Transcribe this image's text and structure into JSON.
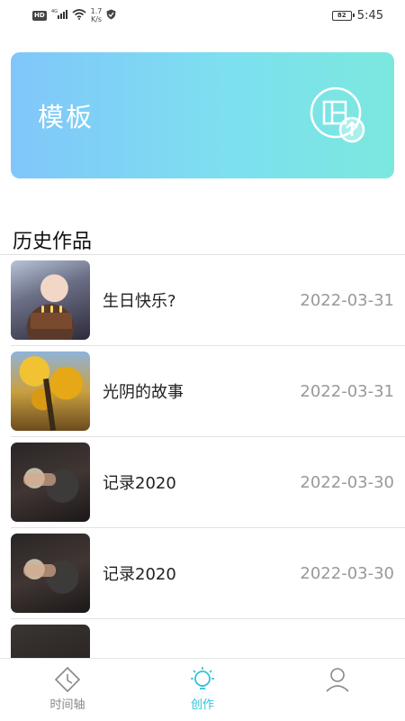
{
  "status_bar": {
    "network_badge": "HD",
    "signal_label": "4G",
    "speed_value": "1.7",
    "speed_unit": "K/s",
    "battery_level": "82",
    "time": "5:45"
  },
  "template_card": {
    "title": "模板",
    "icon": "template-upload-icon",
    "gradient": [
      "#80c6fa",
      "#7be8de"
    ]
  },
  "history": {
    "section_title": "历史作品",
    "items": [
      {
        "title": "生日快乐?",
        "date": "2022-03-31",
        "thumb": "birthday"
      },
      {
        "title": "光阴的故事",
        "date": "2022-03-31",
        "thumb": "tree"
      },
      {
        "title": "记录2020",
        "date": "2022-03-30",
        "thumb": "dark"
      },
      {
        "title": "记录2020",
        "date": "2022-03-30",
        "thumb": "dark"
      },
      {
        "title": "",
        "date": "",
        "thumb": "dark2"
      }
    ]
  },
  "tab_bar": {
    "tabs": [
      {
        "label": "时间轴",
        "icon": "timeline-icon",
        "active": false
      },
      {
        "label": "创作",
        "icon": "create-bulb-icon",
        "active": true
      },
      {
        "label": "",
        "icon": "profile-icon",
        "active": false
      }
    ]
  },
  "colors": {
    "accent": "#2fc3d8",
    "date_text": "#999999",
    "divider": "#e2e2e2"
  }
}
